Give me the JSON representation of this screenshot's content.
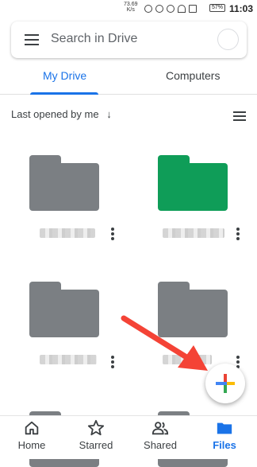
{
  "status_bar": {
    "network_speed": "73.69",
    "network_unit": "K/s",
    "battery": "57%",
    "time": "11:03"
  },
  "search": {
    "placeholder": "Search in Drive"
  },
  "tabs": [
    {
      "label": "My Drive",
      "active": true
    },
    {
      "label": "Computers",
      "active": false
    }
  ],
  "sort": {
    "label": "Last opened by me",
    "direction": "↓"
  },
  "folders": [
    {
      "color": "#7b7f83"
    },
    {
      "color": "#0f9d58"
    },
    {
      "color": "#7b7f83"
    },
    {
      "color": "#7b7f83"
    },
    {
      "color": "#7b7f83"
    },
    {
      "color": "#7b7f83"
    }
  ],
  "fab": {
    "icon": "plus-multicolor-icon"
  },
  "annotation": {
    "color": "#f44336"
  },
  "bottom_nav": [
    {
      "label": "Home",
      "icon": "home-icon",
      "active": false
    },
    {
      "label": "Starred",
      "icon": "star-icon",
      "active": false
    },
    {
      "label": "Shared",
      "icon": "people-icon",
      "active": false
    },
    {
      "label": "Files",
      "icon": "folder-icon",
      "active": true
    }
  ],
  "colors": {
    "accent": "#1a73e8"
  }
}
